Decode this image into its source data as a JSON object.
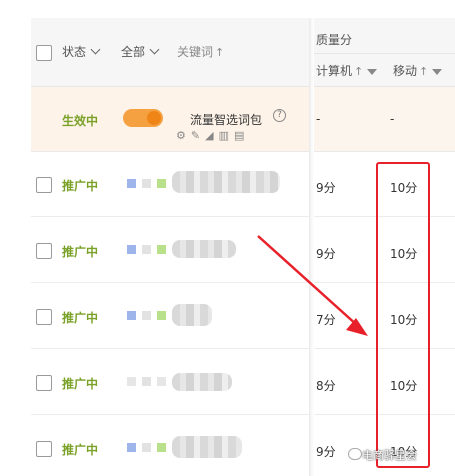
{
  "header": {
    "status_label": "状态",
    "all_label": "全部",
    "keyword_label": "关键词",
    "quality_label": "质量分",
    "computer_label": "计算机",
    "mobile_label": "移动"
  },
  "special_row": {
    "status": "生效中",
    "toggle_on": true,
    "package_name": "流量智选词包",
    "help_glyph": "?",
    "computer_score": "-",
    "mobile_score": "-"
  },
  "rows": [
    {
      "status": "推广中",
      "computer": "9分",
      "mobile": "10分"
    },
    {
      "status": "推广中",
      "computer": "9分",
      "mobile": "10分"
    },
    {
      "status": "推广中",
      "computer": "7分",
      "mobile": "10分"
    },
    {
      "status": "推广中",
      "computer": "8分",
      "mobile": "10分"
    },
    {
      "status": "推广中",
      "computer": "9分",
      "mobile": "10分"
    }
  ],
  "watermark": {
    "text": "电商驿星会"
  },
  "colors": {
    "status_green": "#7aa128",
    "toggle_orange": "#f5a142",
    "highlight_red": "#e8202a",
    "device_blue": "#9db5ea",
    "device_gray": "#e2e2e2",
    "device_green": "#b9e08b"
  },
  "icons": [
    "sort-up-icon",
    "filter-icon",
    "help-icon",
    "settings-icon",
    "wrench-icon",
    "chart-icon",
    "bar-chart-icon",
    "clipboard-icon",
    "chevron-down-icon",
    "arrow-annotation"
  ]
}
